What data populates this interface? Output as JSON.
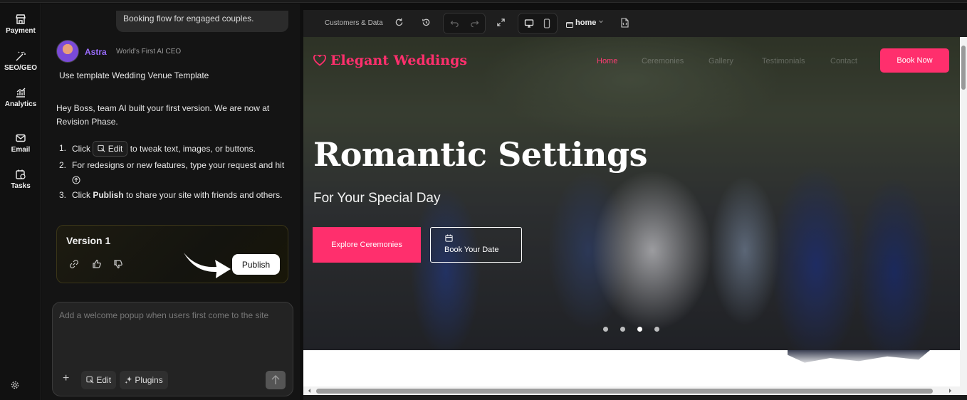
{
  "rail": {
    "items": [
      {
        "label": "Payment",
        "icon": "store-icon"
      },
      {
        "label": "SEO/GEO",
        "icon": "magic-wand-icon"
      },
      {
        "label": "Analytics",
        "icon": "bar-chart-icon"
      },
      {
        "label": "Email",
        "icon": "mail-icon"
      },
      {
        "label": "Tasks",
        "icon": "calendar-clock-icon"
      }
    ]
  },
  "chat": {
    "previous_message": "Booking flow for engaged couples.",
    "sender_name": "Astra",
    "sender_title": "World's First AI CEO",
    "template_line": "Use template Wedding Venue Template",
    "intro": "Hey Boss, team AI built your first version. We are now at Revision Phase.",
    "steps": {
      "s1_num": "1.",
      "s1_pre": "Click",
      "s1_edit": "Edit",
      "s1_post": "to tweak text, images, or buttons.",
      "s2_num": "2.",
      "s2_text": "For redesigns or new features, type your request and hit",
      "s3_num": "3.",
      "s3_pre": "Click",
      "s3_bold": "Publish",
      "s3_post": "to share your site with friends and others."
    },
    "version": {
      "title": "Version 1",
      "publish_label": "Publish"
    },
    "input": {
      "placeholder": "Add a welcome popup when users first come to the site",
      "plus": "+",
      "edit_label": "Edit",
      "plugins_label": "Plugins"
    }
  },
  "toolbar": {
    "label": "Customers & Data",
    "page": "home"
  },
  "site": {
    "logo": "Elegant Weddings",
    "nav": [
      "Home",
      "Ceremonies",
      "Gallery",
      "Testimonials",
      "Contact"
    ],
    "book_now": "Book Now",
    "hero_title": "Romantic Settings",
    "hero_subtitle": "For Your Special Day",
    "explore": "Explore Ceremonies",
    "book_date": "Book Your Date",
    "slides": 4,
    "active_slide": 3
  },
  "colors": {
    "brand_pink": "#ff2f6d",
    "astra_purple": "#9b6dff"
  }
}
